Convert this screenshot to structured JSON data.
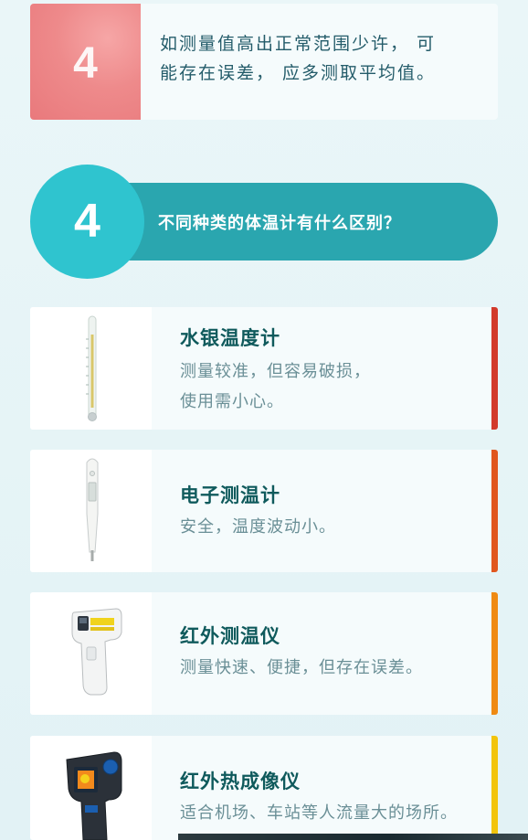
{
  "tip": {
    "number": "4",
    "text_line1": "如测量值高出正常范围少许， 可",
    "text_line2": "能存在误差， 应多测取平均值。",
    "thumb_color": "#ee8a8b"
  },
  "section": {
    "number": "4",
    "title": "不同种类的体温计有什么区别？",
    "circle_color": "#2fc4cf",
    "pill_color": "#2aa6af"
  },
  "types": [
    {
      "name": "水银温度计",
      "desc_line1": "测量较准，但容易破损，",
      "desc_line2": "使用需小心。",
      "icon": "mercury-thermometer-icon",
      "bar_color": "#d23a2b"
    },
    {
      "name": "电子测温计",
      "desc_line1": "安全，温度波动小。",
      "desc_line2": "",
      "icon": "digital-thermometer-icon",
      "bar_color": "#e0571f"
    },
    {
      "name": "红外测温仪",
      "desc_line1": "测量快速、便捷，但存在误差。",
      "desc_line2": "",
      "icon": "infrared-thermometer-icon",
      "bar_color": "#ef8a12"
    },
    {
      "name": "红外热成像仪",
      "desc_line1": "适合机场、车站等人流量大的场所。",
      "desc_line2": "",
      "icon": "thermal-imager-icon",
      "bar_color": "#f2c40c"
    }
  ]
}
